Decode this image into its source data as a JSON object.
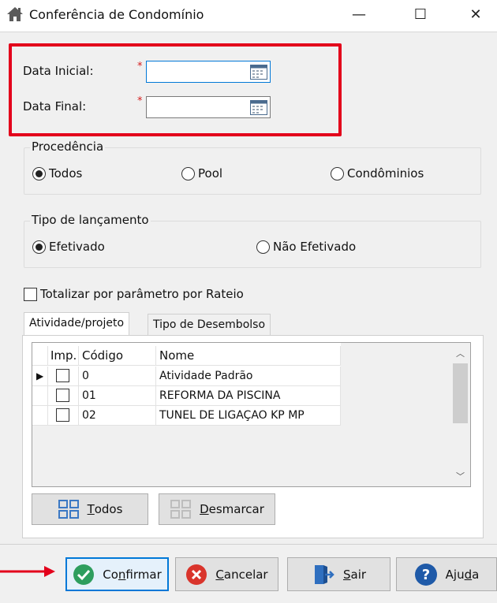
{
  "window": {
    "title": "Conferência de Condomínio",
    "minimize": "—",
    "maximize": "☐",
    "close": "✕"
  },
  "dates": {
    "start_label": "Data Inicial:",
    "end_label": "Data Final:",
    "required_mark": "*",
    "start_value": "",
    "end_value": ""
  },
  "procedencia": {
    "title": "Procedência",
    "options": [
      "Todos",
      "Pool",
      "Condôminios"
    ],
    "selected": "Todos"
  },
  "lancamento": {
    "title": "Tipo de lançamento",
    "options": [
      "Efetivado",
      "Não Efetivado"
    ],
    "selected": "Efetivado"
  },
  "totalizar_label": "Totalizar por parâmetro por Rateio",
  "tabs": [
    "Atividade/projeto",
    "Tipo de Desembolso"
  ],
  "grid": {
    "columns": [
      "Imp.",
      "Código",
      "Nome"
    ],
    "rows": [
      {
        "codigo": "0",
        "nome": "Atividade Padrão"
      },
      {
        "codigo": "01",
        "nome": "REFORMA DA PISCINA"
      },
      {
        "codigo": "02",
        "nome": "TUNEL DE LIGAÇAO KP MP"
      }
    ]
  },
  "grid_buttons": {
    "all_first": "T",
    "all_rest": "odos",
    "none_first": "D",
    "none_rest": "esmarcar"
  },
  "footer_buttons": {
    "confirm_pre": "Co",
    "confirm_u": "n",
    "confirm_post": "firmar",
    "cancel_first": "C",
    "cancel_rest": "ancelar",
    "exit_first": "S",
    "exit_rest": "air",
    "help_pre": "Aju",
    "help_u": "d",
    "help_post": "a"
  },
  "colors": {
    "highlight_box": "#e3001b",
    "arrow": "#e3001b",
    "confirm_icon": "#2e9e5e",
    "cancel_icon": "#d9342b",
    "help_icon": "#1f5aa8",
    "exit_icon": "#2f6fbf"
  }
}
